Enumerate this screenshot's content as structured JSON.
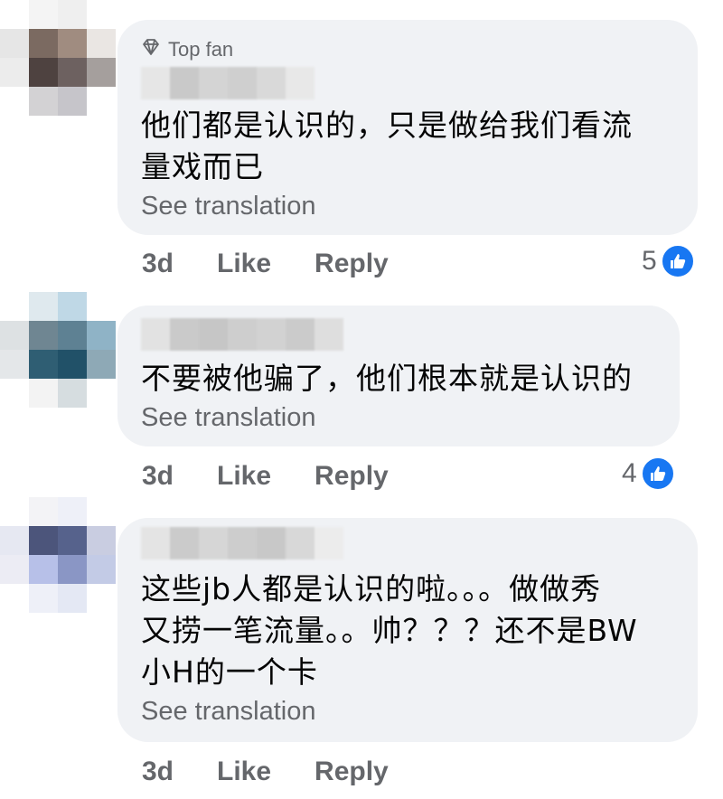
{
  "comments": [
    {
      "badge": "Top fan",
      "text": "他们都是认识的，只是做给我们看流\n量戏而已",
      "see_translation": "See translation",
      "time": "3d",
      "like": "Like",
      "reply": "Reply",
      "reaction_count": "5",
      "reaction_icon": "like-icon",
      "avatar_colors": [
        "#ffffff",
        "#f4f4f4",
        "#efefef",
        "#ffffff",
        "#e6e6e6",
        "#7b6a61",
        "#a08c80",
        "#eae6e3",
        "#ececec",
        "#4e4240",
        "#6d6160",
        "#a59f9d",
        "#ffffff",
        "#d3d2d4",
        "#c6c5ca",
        "#ffffff"
      ],
      "name_colors": [
        "#e6e6e6",
        "#c9c9c9",
        "#d4d4d4",
        "#cfcfcf",
        "#d9d9d9",
        "#e8e8e8"
      ]
    },
    {
      "text": "不要被他骗了，他们根本就是认识的",
      "see_translation": "See translation",
      "time": "3d",
      "like": "Like",
      "reply": "Reply",
      "reaction_count": "4",
      "reaction_icon": "like-icon",
      "avatar_colors": [
        "#ffffff",
        "#dfe9ee",
        "#bfd8e6",
        "#ffffff",
        "#dde1e3",
        "#6f8692",
        "#5e8193",
        "#8fb3c6",
        "#e4e7e9",
        "#2f5e73",
        "#215168",
        "#8ea9b6",
        "#ffffff",
        "#f3f3f3",
        "#d6dde0",
        "#ffffff"
      ],
      "name_colors": [
        "#e2e2e2",
        "#cacaca",
        "#c6c6c6",
        "#cecece",
        "#d2d2d2",
        "#cbcbcb",
        "#dedede"
      ]
    },
    {
      "text": "这些jb人都是认识的啦。。。做做秀\n又捞一笔流量。。帅？？？还不是BW\n小H的一个卡",
      "see_translation": "See translation",
      "time": "3d",
      "like": "Like",
      "reply": "Reply",
      "avatar_colors": [
        "#ffffff",
        "#f3f3f6",
        "#eef0f8",
        "#ffffff",
        "#e6e8f2",
        "#4c557b",
        "#56628c",
        "#c9cde1",
        "#ececf4",
        "#b7c0e8",
        "#8a96c5",
        "#c3cbe6",
        "#ffffff",
        "#eef0f8",
        "#e4e8f4",
        "#ffffff"
      ],
      "name_colors": [
        "#e4e4e4",
        "#cbcbcb",
        "#d6d6d6",
        "#cdcdcd",
        "#c8c8c8",
        "#d8d8d8",
        "#ececec"
      ]
    }
  ],
  "colors": {
    "bubble": "#f0f2f5",
    "secondary_text": "#65676b",
    "like_blue": "#1877f2"
  }
}
